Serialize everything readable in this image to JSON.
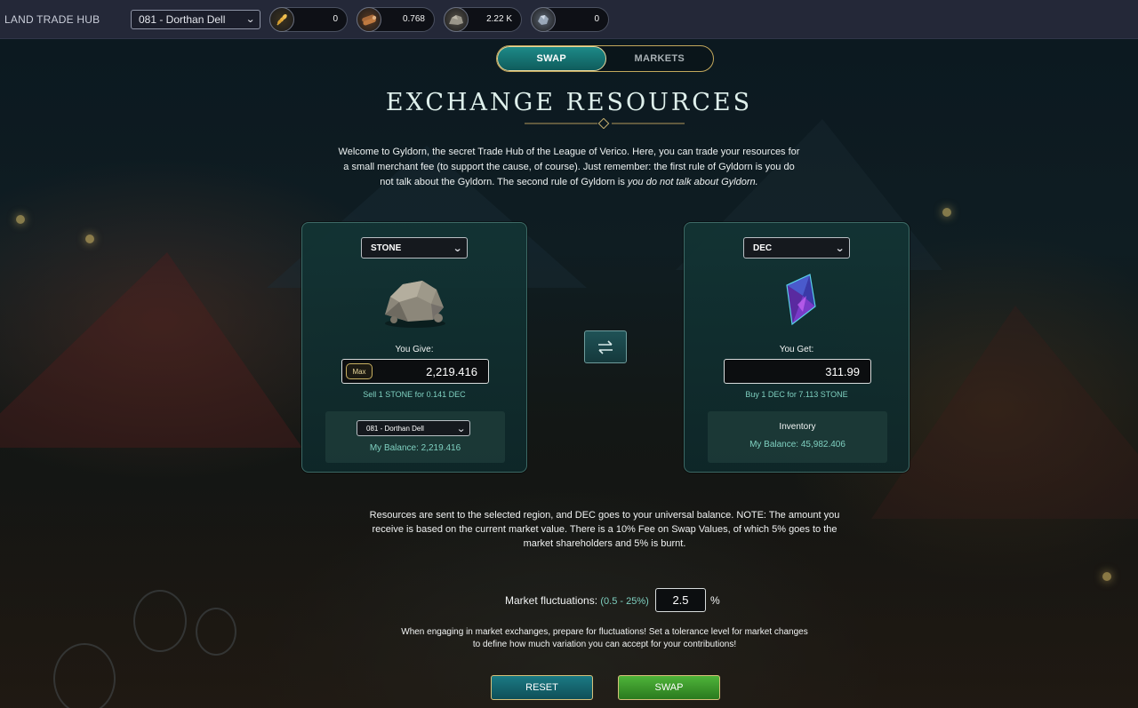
{
  "header": {
    "app_title": "LAND TRADE HUB",
    "region_selected": "081 - Dorthan Dell",
    "resources": [
      {
        "icon": "grain-icon",
        "value": "0"
      },
      {
        "icon": "wood-icon",
        "value": "0.768"
      },
      {
        "icon": "stone-icon",
        "value": "2.22 K"
      },
      {
        "icon": "iron-icon",
        "value": "0"
      }
    ]
  },
  "tabs": [
    {
      "label": "SWAP",
      "active": true
    },
    {
      "label": "MARKETS",
      "active": false
    }
  ],
  "main": {
    "title": "EXCHANGE RESOURCES",
    "intro_text": "Welcome to Gyldorn, the secret Trade Hub of the League of Verico. Here, you can trade your resources for a small merchant fee (to support the cause, of course). Just remember: the first rule of Gyldorn is you do not talk about the Gyldorn. The second rule of Gyldorn is ",
    "intro_emphasis": "you do not talk about Gyldorn."
  },
  "give_panel": {
    "resource": "STONE",
    "label": "You Give:",
    "max_label": "Max",
    "amount": "2,219.416",
    "rate": "Sell 1 STONE for 0.141 DEC",
    "region": "081 - Dorthan Dell",
    "balance": "My Balance: 2,219.416"
  },
  "get_panel": {
    "resource": "DEC",
    "label": "You Get:",
    "amount": "311.99",
    "rate": "Buy 1 DEC for 7.113 STONE",
    "inventory_title": "Inventory",
    "balance": "My Balance: 45,982.406"
  },
  "note": "Resources are sent to the selected region, and DEC goes to your universal balance. NOTE: The amount you receive is based on the current market value. There is a 10% Fee on Swap Values, of which 5% goes to the market shareholders and 5% is burnt.",
  "fluctuation": {
    "label": "Market fluctuations:",
    "range": "(0.5 - 25%)",
    "value": "2.5",
    "unit": "%",
    "help": "When engaging in market exchanges, prepare for fluctuations! Set a tolerance level for market changes to define how much variation you can accept for your contributions!"
  },
  "actions": {
    "reset_label": "RESET",
    "swap_label": "SWAP"
  }
}
